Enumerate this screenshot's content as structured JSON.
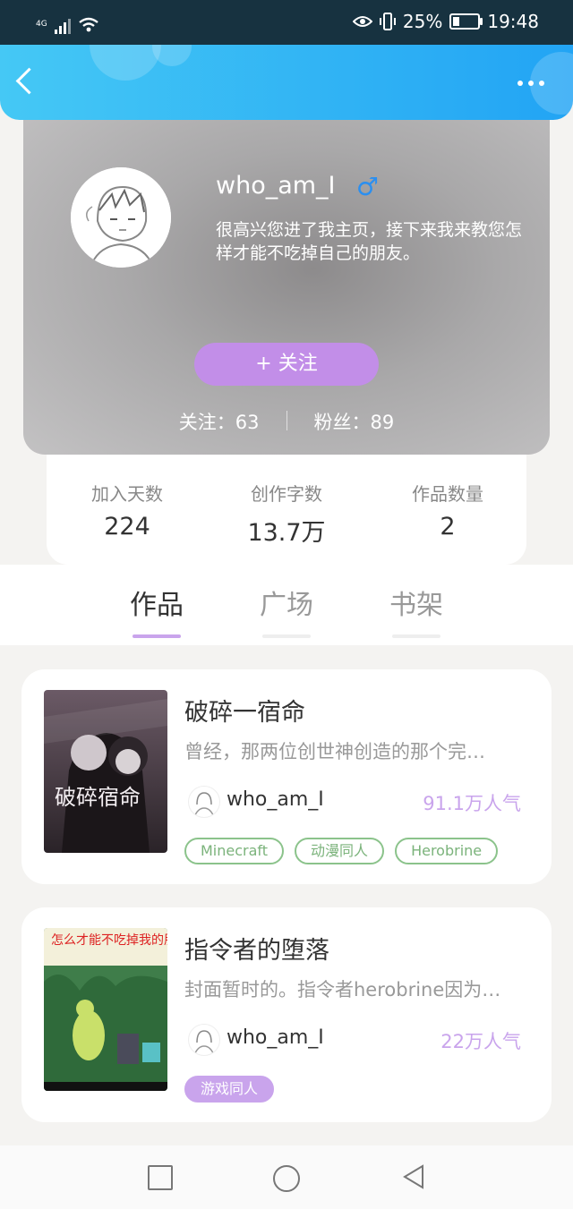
{
  "status_bar": {
    "network": "4G",
    "battery": "25%",
    "time": "19:48"
  },
  "profile": {
    "username": "who_am_I",
    "gender_symbol": "♂",
    "bio": "很高兴您进了我主页，接下来我来教您怎样才能不吃掉自己的朋友。",
    "follow_button": "+  关注",
    "following_label": "关注：63",
    "followers_label": "粉丝：89"
  },
  "stats": [
    {
      "label": "加入天数",
      "value": "224"
    },
    {
      "label": "创作字数",
      "value": "13.7万"
    },
    {
      "label": "作品数量",
      "value": "2"
    }
  ],
  "tabs": [
    {
      "label": "作品",
      "active": true
    },
    {
      "label": "广场",
      "active": false
    },
    {
      "label": "书架",
      "active": false
    }
  ],
  "works": [
    {
      "title": "破碎一宿命",
      "desc": "曾经，那两位创世神创造的那个完…",
      "author": "who_am_I",
      "popularity": "91.1万人气",
      "cover_text": "破碎宿命",
      "tags": [
        "Minecraft",
        "动漫同人",
        "Herobrine"
      ]
    },
    {
      "title": "指令者的堕落",
      "desc": "封面暂时的。指令者herobrine因为…",
      "author": "who_am_I",
      "popularity": "22万人气",
      "cover_text": "怎么才能不吃掉我的朋友?",
      "tags": [
        "游戏同人"
      ]
    }
  ],
  "colors": {
    "header": "#22a4f4",
    "accent": "#c9a4ec",
    "tag_green": "#8bc38b"
  },
  "icons": [
    "back-icon",
    "more-icon",
    "eye-icon",
    "vibrate-icon",
    "battery-icon",
    "wifi-icon",
    "signal-icon",
    "male-icon",
    "nav-square-icon",
    "nav-home-icon",
    "nav-back-icon"
  ]
}
